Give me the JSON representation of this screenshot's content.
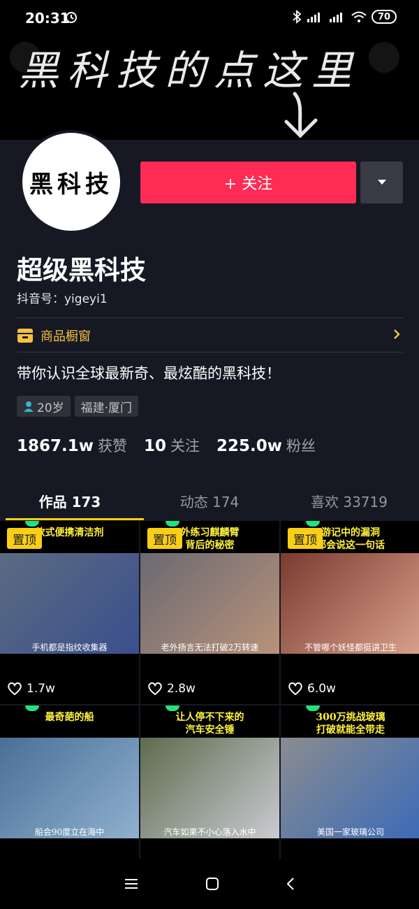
{
  "status_bar": {
    "time": "20:31",
    "battery": "70"
  },
  "banner": {
    "text": "黑科技的点这里"
  },
  "profile": {
    "avatar_text": "黑科技",
    "follow_label": "+ 关注",
    "nickname": "超级黑科技",
    "douyin_id": "抖音号：yigeyi1",
    "shop_label": "商品橱窗",
    "bio": "带你认识全球最新奇、最炫酷的黑科技！",
    "tags": [
      {
        "label": "20岁",
        "icon": "person-icon"
      },
      {
        "label": "福建·厦门"
      }
    ],
    "stats": [
      {
        "num": "1867.1w",
        "label": "获赞"
      },
      {
        "num": "10",
        "label": "关注"
      },
      {
        "num": "225.0w",
        "label": "粉丝"
      }
    ]
  },
  "tabs": [
    {
      "label": "作品 173",
      "active": true
    },
    {
      "label": "动态 174",
      "active": false
    },
    {
      "label": "喜欢 33719",
      "active": false
    }
  ],
  "videos": [
    {
      "pinned": true,
      "pin_label": "置顶",
      "caption_top": "款式便携清洁剂",
      "caption_bottom": "手机都是指纹收集器",
      "likes": "1.7w",
      "thumb_color": "#5b6b80",
      "thumb_accent": "#3a4f8e"
    },
    {
      "pinned": true,
      "pin_label": "置顶",
      "caption_top": "外练习麒麟臂\n背后的秘密",
      "caption_bottom": "老外扬言无法打破2万转速",
      "likes": "2.8w",
      "thumb_color": "#6b6a72",
      "thumb_accent": "#b8927a"
    },
    {
      "pinned": true,
      "pin_label": "置顶",
      "caption_top": "游记中的漏洞\n都会说这一句话",
      "caption_bottom": "不管哪个妖怪都挺讲卫生",
      "likes": "6.0w",
      "thumb_color": "#7a3b30",
      "thumb_accent": "#d8a08a"
    },
    {
      "pinned": false,
      "caption_top": "最奇葩的船",
      "caption_bottom": "船会90度立在海中",
      "likes": "",
      "thumb_color": "#4a6f96",
      "thumb_accent": "#8fb1cf"
    },
    {
      "pinned": false,
      "caption_top": "让人停不下来的\n汽车安全锤",
      "caption_bottom": "汽车如果不小心落入水中",
      "likes": "",
      "thumb_color": "#5e6b4e",
      "thumb_accent": "#c9ccd1"
    },
    {
      "pinned": false,
      "caption_top": "300万挑战玻璃\n打破就能全带走",
      "caption_bottom": "美国一家玻璃公司",
      "likes": "",
      "thumb_color": "#8a8c90",
      "thumb_accent": "#3c6bb8"
    }
  ]
}
